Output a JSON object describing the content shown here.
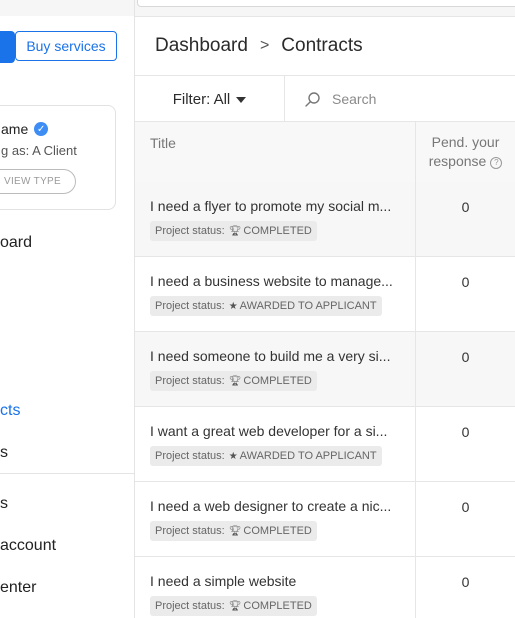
{
  "sidebar": {
    "buy_services_label": "Buy services",
    "profile": {
      "name": "ame",
      "role": "g as: A Client",
      "switch_label": "CH VIEW TYPE"
    },
    "nav": {
      "dashboard": "oard",
      "contracts": "cts",
      "item_s1": "s",
      "item_s2": "s",
      "account": "account",
      "center": "enter"
    }
  },
  "breadcrumb": {
    "home": "Dashboard",
    "separator": ">",
    "current": "Contracts"
  },
  "toolbar": {
    "filter_label": "Filter: All",
    "search_placeholder": "Search"
  },
  "table": {
    "headers": {
      "title": "Title",
      "pending_line1": "Pend. your",
      "pending_line2": "response"
    },
    "rows": [
      {
        "title": "I need a flyer to promote my social m...",
        "status_label": "Project status:",
        "status_icon": "trophy-icon",
        "status": "COMPLETED",
        "pending": "0"
      },
      {
        "title": "I need a business website to manage...",
        "status_label": "Project status:",
        "status_icon": "star-icon",
        "status": "AWARDED TO APPLICANT",
        "pending": "0"
      },
      {
        "title": "I need someone to build me a very si...",
        "status_label": "Project status:",
        "status_icon": "trophy-icon",
        "status": "COMPLETED",
        "pending": "0"
      },
      {
        "title": "I want a great web developer for a si...",
        "status_label": "Project status:",
        "status_icon": "star-icon",
        "status": "AWARDED TO APPLICANT",
        "pending": "0"
      },
      {
        "title": "I need a web designer to create a nic...",
        "status_label": "Project status:",
        "status_icon": "trophy-icon",
        "status": "COMPLETED",
        "pending": "0"
      },
      {
        "title": "I need a simple website",
        "status_label": "Project status:",
        "status_icon": "trophy-icon",
        "status": "COMPLETED",
        "pending": "0"
      }
    ]
  },
  "colors": {
    "accent": "#1a73e8",
    "verified": "#3d8df5"
  }
}
